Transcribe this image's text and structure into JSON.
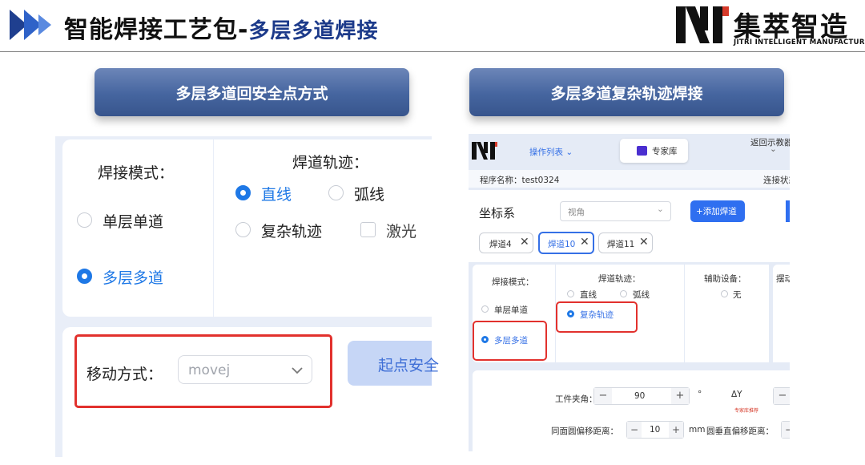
{
  "header": {
    "title_main": "智能焊接工艺包-",
    "title_highlight": "多层多道焊接",
    "logo_cn": "集萃智造",
    "logo_en": "JITRI INTELLIGENT MANUFACTURING"
  },
  "banners": {
    "left": "多层多道回安全点方式",
    "right": "多层多道复杂轨迹焊接"
  },
  "left_panel": {
    "mode_label": "焊接模式：",
    "mode_options": [
      "单层单道",
      "多层多道"
    ],
    "mode_selected": "多层多道",
    "track_label": "焊道轨迹：",
    "track_options": [
      "直线",
      "弧线",
      "复杂轨迹"
    ],
    "track_selected": "直线",
    "laser_label": "激光",
    "move_label": "移动方式：",
    "move_value": "movej",
    "start_button": "起点安全"
  },
  "right_panel": {
    "menu_label": "操作列表",
    "expert_button": "专家库",
    "back_label": "返回示教器",
    "program_label": "程序名称：test0324",
    "connection_label": "连接状态",
    "coord_label": "坐标系",
    "view_select": "视角",
    "add_weld_button": "+添加焊道",
    "tags": [
      "焊道4",
      "焊道10",
      "焊道11"
    ],
    "active_tag": "焊道10",
    "mode_label": "焊接模式：",
    "mode_options": [
      "单层单道",
      "多层多道"
    ],
    "track_label": "焊道轨迹：",
    "track_options": [
      "直线",
      "弧线",
      "复杂轨迹"
    ],
    "aux_label": "辅助设备：",
    "aux_option": "无",
    "swing_label": "摆动",
    "clamp_label": "工件夹角：",
    "clamp_value": "90",
    "degree_unit": "°",
    "delta_y_label": "ΔY",
    "recommend_note": "专家库推荐",
    "offset_label": "同面圆偏移距离：",
    "offset_value": "10",
    "offset_unit": "mm",
    "vertical_label": "圆垂直偏移距离："
  }
}
